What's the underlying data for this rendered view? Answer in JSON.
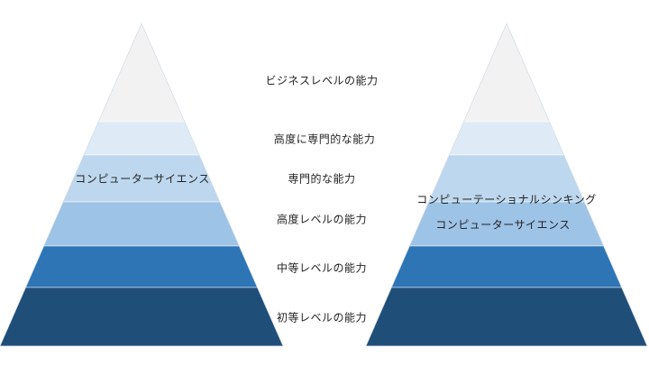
{
  "levels": [
    {
      "label": "ビジネスレベルの能力",
      "color": "#f2f2f2"
    },
    {
      "label": "高度に専門的な能力",
      "color": "#deebf7"
    },
    {
      "label": "専門的な能力",
      "color": "#bdd7ee"
    },
    {
      "label": "高度レベルの能力",
      "color": "#9dc3e6"
    },
    {
      "label": "中等レベルの能力",
      "color": "#2e75b6"
    },
    {
      "label": "初等レベルの能力",
      "color": "#1f4e79"
    }
  ],
  "left_pyramid": {
    "label": "コンピューターサイエンス"
  },
  "right_pyramid": {
    "label_top": "コンピューテーショナルシンキング",
    "label_bottom": "コンピューターサイエンス"
  }
}
